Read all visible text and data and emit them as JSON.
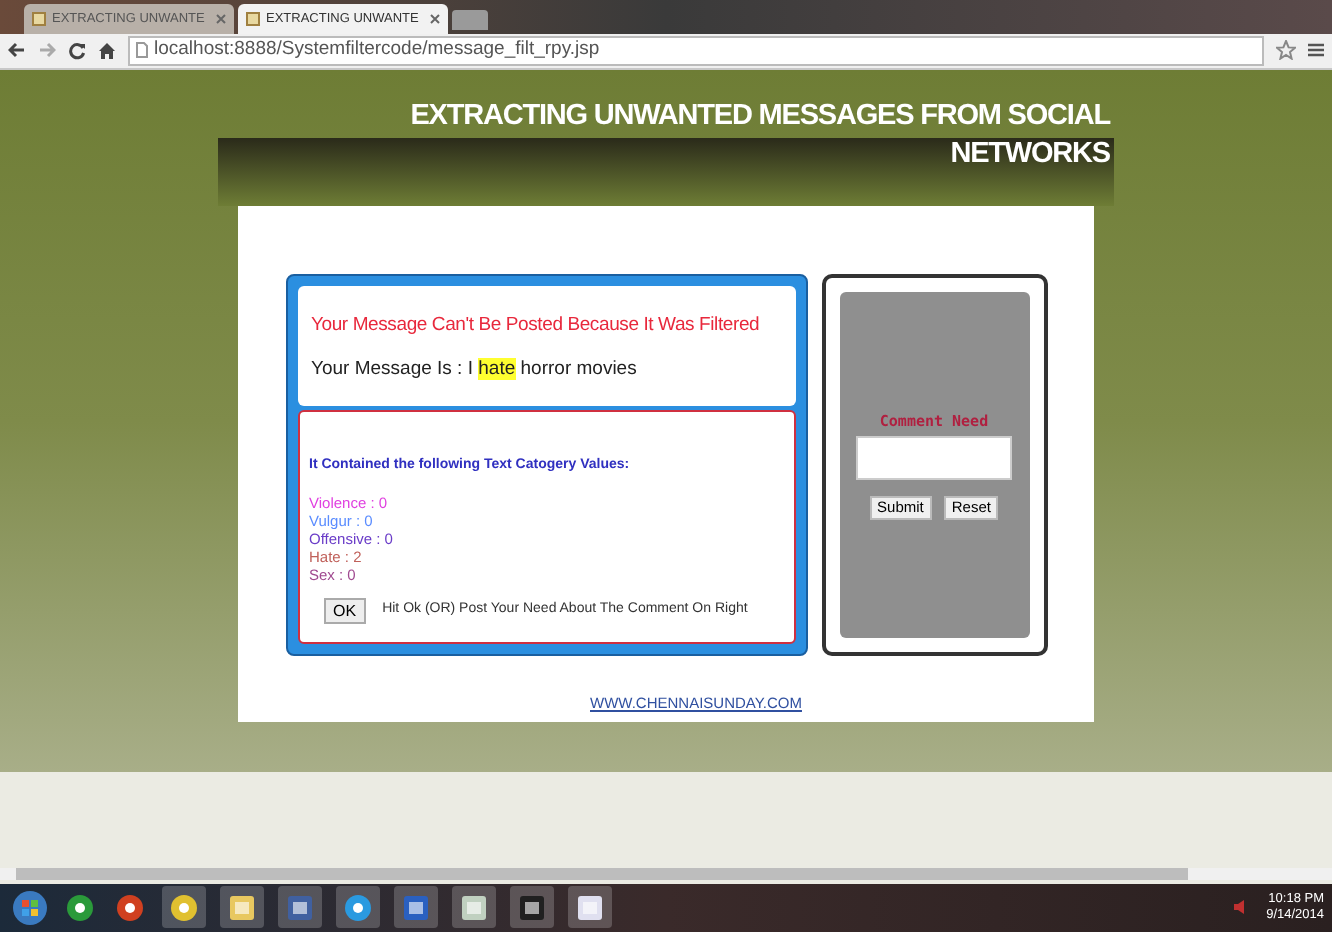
{
  "browser": {
    "tabs": [
      {
        "label": "EXTRACTING UNWANTE",
        "selected": false
      },
      {
        "label": "EXTRACTING UNWANTE",
        "selected": true
      }
    ],
    "address": "localhost:8888/Systemfiltercode/message_filt_rpy.jsp"
  },
  "page": {
    "title": "EXTRACTING UNWANTED MESSAGES FROM SOCIAL NETWORKS",
    "filtered_heading": "Your Message Can't Be Posted Because It Was Filtered",
    "message_label": "Your Message Is :",
    "message_words": [
      {
        "text": "I",
        "highlighted": false
      },
      {
        "text": "hate",
        "highlighted": true
      },
      {
        "text": "horror movies",
        "highlighted": false
      }
    ],
    "categories_heading": "It Contained the following Text Catogery Values:",
    "categories": [
      {
        "text": "Violence : 0",
        "color": "#e040e0"
      },
      {
        "text": "Vulgur : 0",
        "color": "#5a8cff"
      },
      {
        "text": "Offensive : 0",
        "color": "#6a3cc8"
      },
      {
        "text": "Hate : 2",
        "color": "#c0605a"
      },
      {
        "text": "Sex : 0",
        "color": "#a04a90"
      }
    ],
    "ok_button": "OK",
    "hint": "Hit Ok (OR) Post Your Need About The Comment On Right",
    "comment_label": "Comment Need",
    "submit_button": "Submit",
    "reset_button": "Reset",
    "footer_link": "WWW.CHENNAISUNDAY.COM"
  },
  "taskbar": {
    "time": "10:18 PM",
    "date": "9/14/2014"
  }
}
